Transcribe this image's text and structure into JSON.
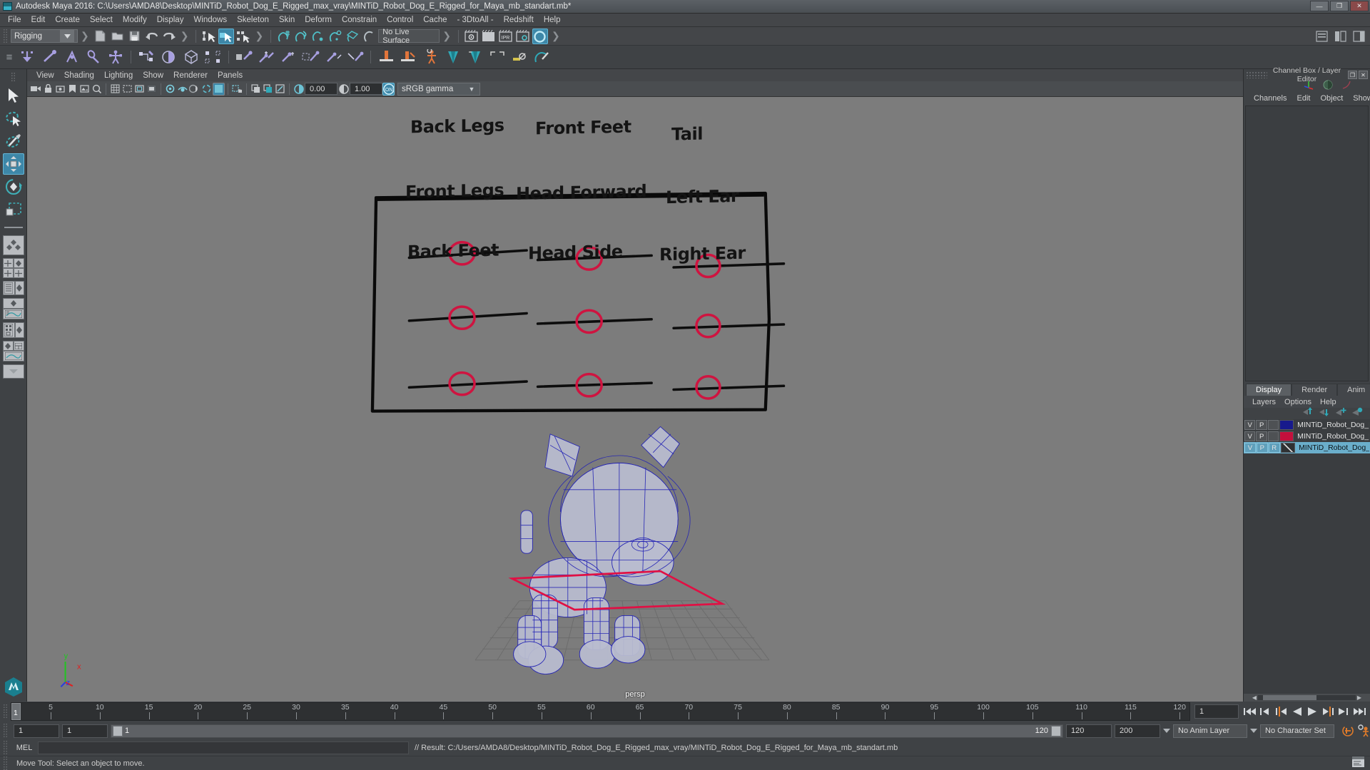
{
  "titlebar": {
    "text": "Autodesk Maya 2016: C:\\Users\\AMDA8\\Desktop\\MINTiD_Robot_Dog_E_Rigged_max_vray\\MINTiD_Robot_Dog_E_Rigged_for_Maya_mb_standart.mb*",
    "minimize": "—",
    "maximize": "❐",
    "close": "✕"
  },
  "menubar": {
    "items": [
      "File",
      "Edit",
      "Create",
      "Select",
      "Modify",
      "Display",
      "Windows",
      "Skeleton",
      "Skin",
      "Deform",
      "Constrain",
      "Control",
      "Cache",
      "- 3DtoAll -",
      "Redshift",
      "Help"
    ]
  },
  "statusline": {
    "menuset": "Rigging",
    "live_surface": "No Live Surface",
    "ipr_label": "IPR"
  },
  "panelmenu": {
    "items": [
      "View",
      "Shading",
      "Lighting",
      "Show",
      "Renderer",
      "Panels"
    ]
  },
  "viewtools": {
    "exposure": "0.00",
    "gamma_value": "1.00",
    "color_management": "sRGB gamma",
    "cm_toggle": "ON"
  },
  "viewport": {
    "camera_label": "persp",
    "axis": {
      "x": "x",
      "y": "y",
      "z": "z"
    },
    "background_color": "#7c7c7c",
    "wireframe_color": "#2323b4",
    "control_color": "#cf1440",
    "whiteboard": {
      "controls": [
        {
          "label": "Back Legs",
          "col": 0,
          "row": 0
        },
        {
          "label": "Front Feet",
          "col": 1,
          "row": 0
        },
        {
          "label": "Tail",
          "col": 2,
          "row": 0
        },
        {
          "label": "Front Legs",
          "col": 0,
          "row": 1
        },
        {
          "label": "Head Forward",
          "col": 1,
          "row": 1
        },
        {
          "label": "Left Ear",
          "col": 2,
          "row": 1
        },
        {
          "label": "Back Feet",
          "col": 0,
          "row": 2
        },
        {
          "label": "Head Side",
          "col": 1,
          "row": 2
        },
        {
          "label": "Right Ear",
          "col": 2,
          "row": 2
        }
      ]
    }
  },
  "channelbox": {
    "title": "Channel Box / Layer Editor",
    "restore": "❐",
    "close": "✕",
    "menu": [
      "Channels",
      "Edit",
      "Object",
      "Show"
    ]
  },
  "layereditor": {
    "tabs": [
      "Display",
      "Render",
      "Anim"
    ],
    "active_tab": "Display",
    "menu": [
      "Layers",
      "Options",
      "Help"
    ],
    "layers": [
      {
        "v": "V",
        "p": "P",
        "r": "",
        "color": "#171a8c",
        "name": "MINTiD_Robot_Dog_E_",
        "selected": false
      },
      {
        "v": "V",
        "p": "P",
        "r": "",
        "color": "#c4103c",
        "name": "MINTiD_Robot_Dog_E_",
        "selected": false
      },
      {
        "v": "V",
        "p": "P",
        "r": "R",
        "color": "#9c9ca0",
        "name": "MINTiD_Robot_Dog_E",
        "selected": true
      }
    ]
  },
  "timeslider": {
    "ticks": [
      5,
      10,
      15,
      20,
      25,
      30,
      35,
      40,
      45,
      50,
      55,
      60,
      65,
      70,
      75,
      80,
      85,
      90,
      95,
      100,
      105,
      110,
      115,
      120
    ],
    "start_frame": "1",
    "end_frame": "120",
    "current_frame": "1",
    "playhead_label": "1"
  },
  "rangeslider": {
    "anim_start": "1",
    "range_start": "1",
    "range_start_label": "1",
    "range_end_label": "120",
    "range_end": "120",
    "anim_end": "200",
    "anim_layer": "No Anim Layer",
    "character_set": "No Character Set"
  },
  "commandline": {
    "mel_label": "MEL",
    "input_value": "",
    "result": "// Result: C:/Users/AMDA8/Desktop/MINTiD_Robot_Dog_E_Rigged_max_vray/MINTiD_Robot_Dog_E_Rigged_for_Maya_mb_standart.mb"
  },
  "helpline": {
    "text": "Move Tool: Select an object to move."
  }
}
